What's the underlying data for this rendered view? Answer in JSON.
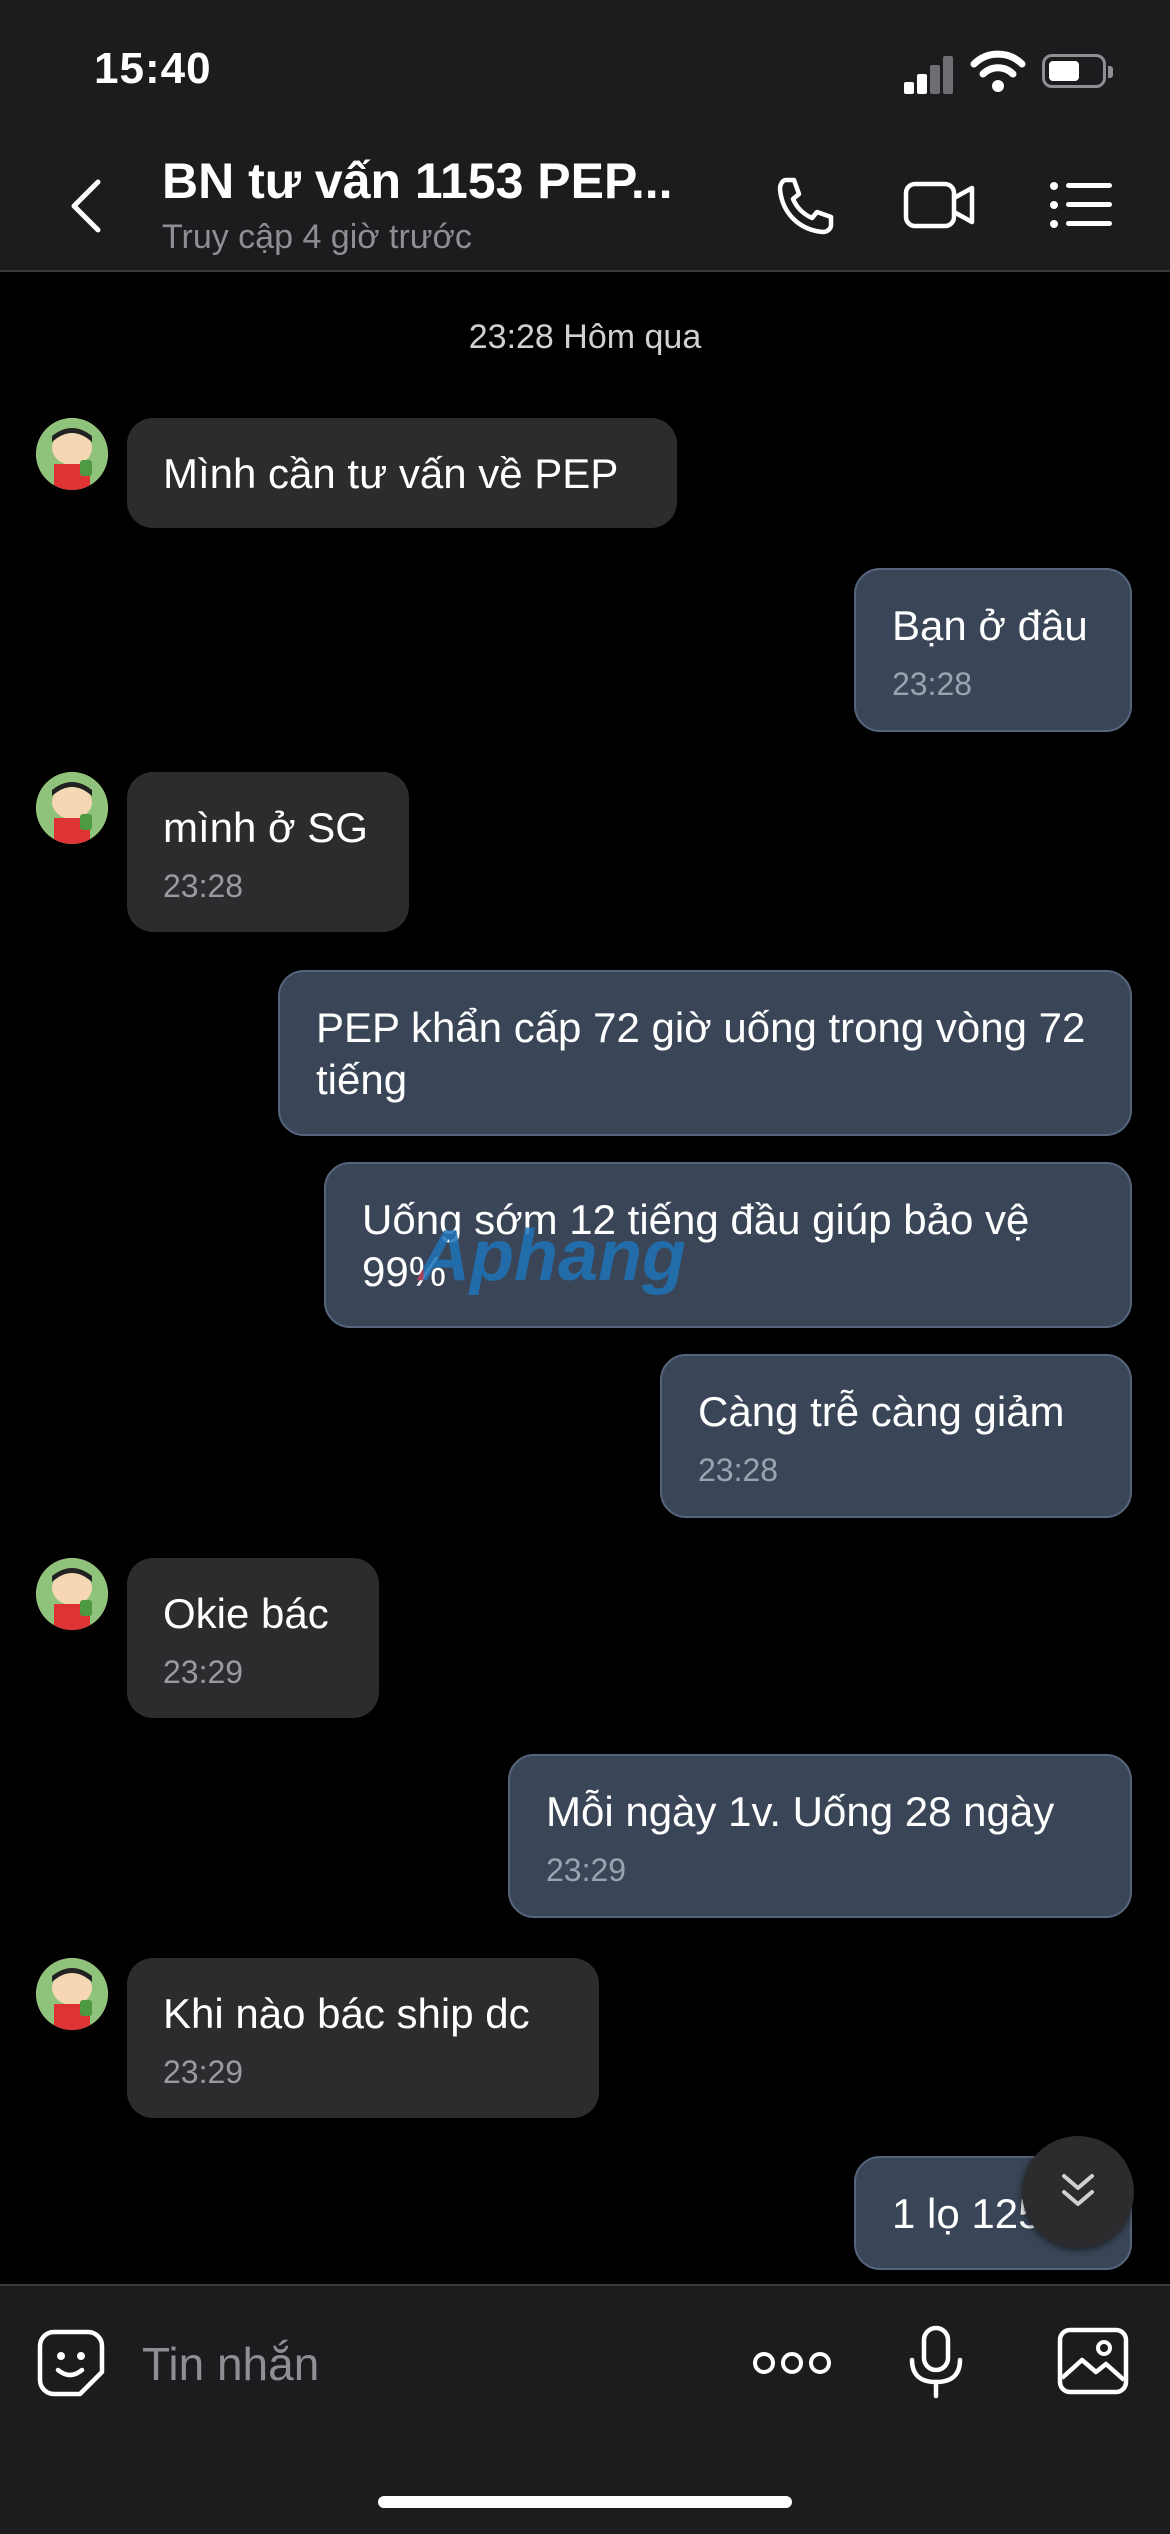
{
  "status_bar": {
    "time": "15:40"
  },
  "header": {
    "title": "BN tư vấn 1153 PEP...",
    "subtitle": "Truy cập 4 giờ trước"
  },
  "chat": {
    "date_separator": "23:28 Hôm qua",
    "messages": [
      {
        "side": "in",
        "text": "Mình cần tư vấn về PEP",
        "time": ""
      },
      {
        "side": "out",
        "text": "Bạn ở đâu",
        "time": "23:28"
      },
      {
        "side": "in",
        "text": "mình ở SG",
        "time": "23:28"
      },
      {
        "side": "out",
        "text": "PEP khẩn cấp 72 giờ uống trong vòng 72 tiếng",
        "time": ""
      },
      {
        "side": "out",
        "text": "Uống sớm 12 tiếng đầu giúp bảo vệ 99%",
        "time": ""
      },
      {
        "side": "out",
        "text": "Càng trễ càng giảm",
        "time": "23:28"
      },
      {
        "side": "in",
        "text": "Okie bác",
        "time": "23:29"
      },
      {
        "side": "out",
        "text": "Mỗi ngày 1v. Uống 28 ngày",
        "time": "23:29"
      },
      {
        "side": "in",
        "text": "Khi nào bác ship dc",
        "time": "23:29"
      },
      {
        "side": "out",
        "text": "1 lọ 125",
        "time": ""
      }
    ]
  },
  "watermark": {
    "text": "Aphang"
  },
  "composer": {
    "placeholder": "Tin nhắn"
  },
  "icons": {
    "back": "chevron-left-icon",
    "call": "phone-icon",
    "video": "video-camera-icon",
    "menu": "list-icon",
    "emoji": "sticker-face-icon",
    "more": "ellipsis-icon",
    "mic": "microphone-icon",
    "gallery": "image-icon",
    "scroll": "double-chevron-down-icon"
  },
  "colors": {
    "incoming_bubble": "#2c2c2e",
    "outgoing_bubble": "#3a4658",
    "background": "#000000",
    "bar": "#1c1c1e"
  }
}
